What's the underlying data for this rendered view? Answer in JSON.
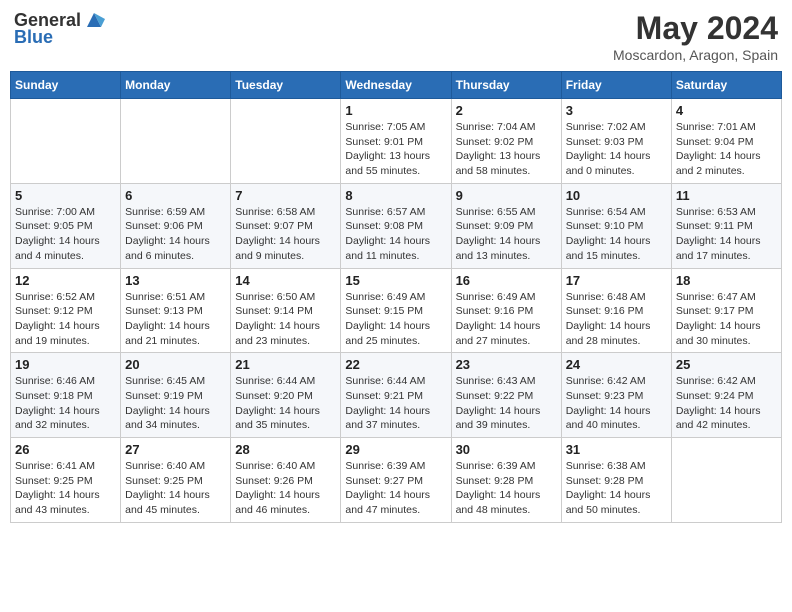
{
  "header": {
    "logo_general": "General",
    "logo_blue": "Blue",
    "month_title": "May 2024",
    "location": "Moscardon, Aragon, Spain"
  },
  "days_of_week": [
    "Sunday",
    "Monday",
    "Tuesday",
    "Wednesday",
    "Thursday",
    "Friday",
    "Saturday"
  ],
  "weeks": [
    [
      {
        "day": "",
        "info": ""
      },
      {
        "day": "",
        "info": ""
      },
      {
        "day": "",
        "info": ""
      },
      {
        "day": "1",
        "info": "Sunrise: 7:05 AM\nSunset: 9:01 PM\nDaylight: 13 hours\nand 55 minutes."
      },
      {
        "day": "2",
        "info": "Sunrise: 7:04 AM\nSunset: 9:02 PM\nDaylight: 13 hours\nand 58 minutes."
      },
      {
        "day": "3",
        "info": "Sunrise: 7:02 AM\nSunset: 9:03 PM\nDaylight: 14 hours\nand 0 minutes."
      },
      {
        "day": "4",
        "info": "Sunrise: 7:01 AM\nSunset: 9:04 PM\nDaylight: 14 hours\nand 2 minutes."
      }
    ],
    [
      {
        "day": "5",
        "info": "Sunrise: 7:00 AM\nSunset: 9:05 PM\nDaylight: 14 hours\nand 4 minutes."
      },
      {
        "day": "6",
        "info": "Sunrise: 6:59 AM\nSunset: 9:06 PM\nDaylight: 14 hours\nand 6 minutes."
      },
      {
        "day": "7",
        "info": "Sunrise: 6:58 AM\nSunset: 9:07 PM\nDaylight: 14 hours\nand 9 minutes."
      },
      {
        "day": "8",
        "info": "Sunrise: 6:57 AM\nSunset: 9:08 PM\nDaylight: 14 hours\nand 11 minutes."
      },
      {
        "day": "9",
        "info": "Sunrise: 6:55 AM\nSunset: 9:09 PM\nDaylight: 14 hours\nand 13 minutes."
      },
      {
        "day": "10",
        "info": "Sunrise: 6:54 AM\nSunset: 9:10 PM\nDaylight: 14 hours\nand 15 minutes."
      },
      {
        "day": "11",
        "info": "Sunrise: 6:53 AM\nSunset: 9:11 PM\nDaylight: 14 hours\nand 17 minutes."
      }
    ],
    [
      {
        "day": "12",
        "info": "Sunrise: 6:52 AM\nSunset: 9:12 PM\nDaylight: 14 hours\nand 19 minutes."
      },
      {
        "day": "13",
        "info": "Sunrise: 6:51 AM\nSunset: 9:13 PM\nDaylight: 14 hours\nand 21 minutes."
      },
      {
        "day": "14",
        "info": "Sunrise: 6:50 AM\nSunset: 9:14 PM\nDaylight: 14 hours\nand 23 minutes."
      },
      {
        "day": "15",
        "info": "Sunrise: 6:49 AM\nSunset: 9:15 PM\nDaylight: 14 hours\nand 25 minutes."
      },
      {
        "day": "16",
        "info": "Sunrise: 6:49 AM\nSunset: 9:16 PM\nDaylight: 14 hours\nand 27 minutes."
      },
      {
        "day": "17",
        "info": "Sunrise: 6:48 AM\nSunset: 9:16 PM\nDaylight: 14 hours\nand 28 minutes."
      },
      {
        "day": "18",
        "info": "Sunrise: 6:47 AM\nSunset: 9:17 PM\nDaylight: 14 hours\nand 30 minutes."
      }
    ],
    [
      {
        "day": "19",
        "info": "Sunrise: 6:46 AM\nSunset: 9:18 PM\nDaylight: 14 hours\nand 32 minutes."
      },
      {
        "day": "20",
        "info": "Sunrise: 6:45 AM\nSunset: 9:19 PM\nDaylight: 14 hours\nand 34 minutes."
      },
      {
        "day": "21",
        "info": "Sunrise: 6:44 AM\nSunset: 9:20 PM\nDaylight: 14 hours\nand 35 minutes."
      },
      {
        "day": "22",
        "info": "Sunrise: 6:44 AM\nSunset: 9:21 PM\nDaylight: 14 hours\nand 37 minutes."
      },
      {
        "day": "23",
        "info": "Sunrise: 6:43 AM\nSunset: 9:22 PM\nDaylight: 14 hours\nand 39 minutes."
      },
      {
        "day": "24",
        "info": "Sunrise: 6:42 AM\nSunset: 9:23 PM\nDaylight: 14 hours\nand 40 minutes."
      },
      {
        "day": "25",
        "info": "Sunrise: 6:42 AM\nSunset: 9:24 PM\nDaylight: 14 hours\nand 42 minutes."
      }
    ],
    [
      {
        "day": "26",
        "info": "Sunrise: 6:41 AM\nSunset: 9:25 PM\nDaylight: 14 hours\nand 43 minutes."
      },
      {
        "day": "27",
        "info": "Sunrise: 6:40 AM\nSunset: 9:25 PM\nDaylight: 14 hours\nand 45 minutes."
      },
      {
        "day": "28",
        "info": "Sunrise: 6:40 AM\nSunset: 9:26 PM\nDaylight: 14 hours\nand 46 minutes."
      },
      {
        "day": "29",
        "info": "Sunrise: 6:39 AM\nSunset: 9:27 PM\nDaylight: 14 hours\nand 47 minutes."
      },
      {
        "day": "30",
        "info": "Sunrise: 6:39 AM\nSunset: 9:28 PM\nDaylight: 14 hours\nand 48 minutes."
      },
      {
        "day": "31",
        "info": "Sunrise: 6:38 AM\nSunset: 9:28 PM\nDaylight: 14 hours\nand 50 minutes."
      },
      {
        "day": "",
        "info": ""
      }
    ]
  ]
}
